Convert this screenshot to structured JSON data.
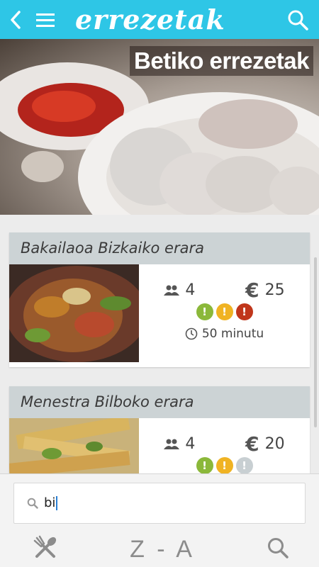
{
  "header": {
    "logo": "errezetak"
  },
  "hero": {
    "title": "Betiko errezetak"
  },
  "recipes": [
    {
      "title": "Bakailaoa Bizkaiko erara",
      "people": "4",
      "price_symbol": "€",
      "price": "25",
      "time": "50 minutu",
      "difficulty_colors": [
        "#8bb83a",
        "#f0b323",
        "#c0361b"
      ]
    },
    {
      "title": "Menestra Bilboko erara",
      "people": "4",
      "price_symbol": "€",
      "price": "20",
      "difficulty_colors": [
        "#8bb83a",
        "#f0b323",
        "#c8cfd2"
      ]
    }
  ],
  "search": {
    "value": "bi"
  },
  "toolbar": {
    "sort_label": "Z - A"
  },
  "icons": {
    "back": "back-arrow-icon",
    "menu": "hamburger-menu-icon",
    "search": "search-icon",
    "people": "people-icon",
    "clock": "clock-icon",
    "cutlery": "cutlery-icon"
  },
  "colors": {
    "header": "#2ec6e6",
    "card_title_bg": "#ccd3d5"
  }
}
